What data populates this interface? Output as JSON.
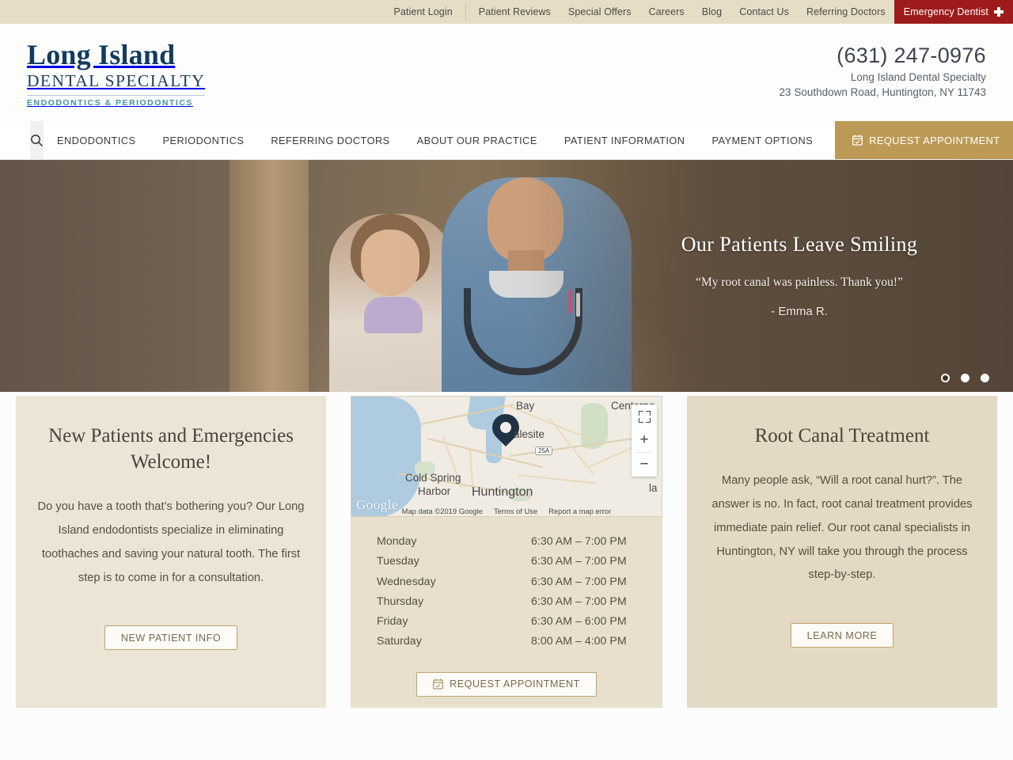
{
  "topbar": {
    "links": [
      "Patient Login",
      "Patient Reviews",
      "Special Offers",
      "Careers",
      "Blog",
      "Contact Us",
      "Referring Doctors"
    ],
    "emergency_label": "Emergency Dentist",
    "emergency_bg": "#9e1b1b"
  },
  "logo": {
    "line1": "Long Island",
    "line2": "DENTAL SPECIALTY",
    "line3": "ENDODONTICS & PERIODONTICS",
    "color": "#123b5e",
    "accent": "#3f95b0"
  },
  "contact": {
    "phone": "(631) 247-0976",
    "practice_name": "Long Island Dental Specialty",
    "address": "23 Southdown Road, Huntington, NY 11743"
  },
  "nav": {
    "search_icon": "search-icon",
    "items": [
      "ENDODONTICS",
      "PERIODONTICS",
      "REFERRING DOCTORS",
      "ABOUT OUR PRACTICE",
      "PATIENT INFORMATION",
      "PAYMENT OPTIONS"
    ],
    "cta_label": "REQUEST APPOINTMENT",
    "cta_icon": "calendar-icon",
    "cta_bg": "#bc9a55"
  },
  "hero": {
    "title": "Our Patients Leave Smiling",
    "quote": "“My root canal was painless. Thank you!”",
    "author": "- Emma R.",
    "slides": 3,
    "active_slide": 1
  },
  "cards": {
    "left": {
      "title": "New Patients and Emergencies Welcome!",
      "body": "Do you have a tooth that’s bothering you? Our Long Island endodontists specialize in eliminating toothaches and saving your natural tooth. The first step is to come in for a consultation.",
      "button": "NEW PATIENT INFO"
    },
    "middle": {
      "button": "REQUEST APPOINTMENT",
      "button_icon": "calendar-icon",
      "hours": [
        {
          "day": "Monday",
          "time": "6:30 AM – 7:00 PM"
        },
        {
          "day": "Tuesday",
          "time": "6:30 AM – 7:00 PM"
        },
        {
          "day": "Wednesday",
          "time": "6:30 AM – 7:00 PM"
        },
        {
          "day": "Thursday",
          "time": "6:30 AM – 7:00 PM"
        },
        {
          "day": "Friday",
          "time": "6:30 AM – 6:00 PM"
        },
        {
          "day": "Saturday",
          "time": "8:00 AM – 4:00 PM"
        }
      ],
      "map": {
        "labels": [
          "Bay",
          "Centerpo",
          "alesite",
          "Cold Spring",
          "Harbor",
          "Huntington",
          "la"
        ],
        "route_shield": "25A",
        "watermark": "Google",
        "attribution": "Map data ©2019 Google",
        "terms": "Terms of Use",
        "report": "Report a map error",
        "zoom_in": "+",
        "zoom_out": "−"
      }
    },
    "right": {
      "title": "Root Canal Treatment",
      "body": "Many people ask, “Will a root canal hurt?”. The answer is no. In fact, root canal treatment provides immediate pain relief. Our root canal specialists in Huntington, NY will take you through the process step-by-step.",
      "button": "LEARN MORE"
    }
  }
}
